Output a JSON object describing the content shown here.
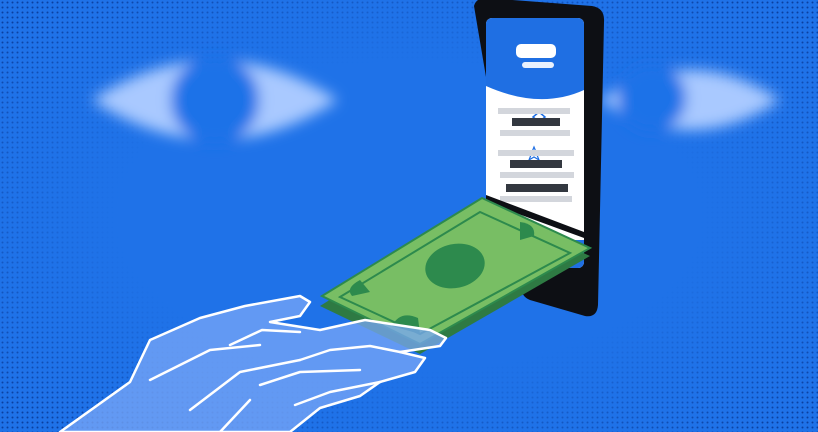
{
  "illustration": {
    "subject": "hand-receiving-cash-from-smartphone",
    "colors": {
      "background": "#1f72e8",
      "dots": "#0b3f9e",
      "eye_glow": "#a9c9ff",
      "phone_body": "#0d0f14",
      "phone_header": "#1f6fe3",
      "phone_screen": "#ffffff",
      "bill_green": "#78be64",
      "bill_dark": "#2d8a4d",
      "hand_fill": "#79a7f7",
      "hand_line": "#ffffff"
    },
    "icons": [
      "eye-icon",
      "eye-icon",
      "diamond-icon",
      "star-icon"
    ]
  }
}
